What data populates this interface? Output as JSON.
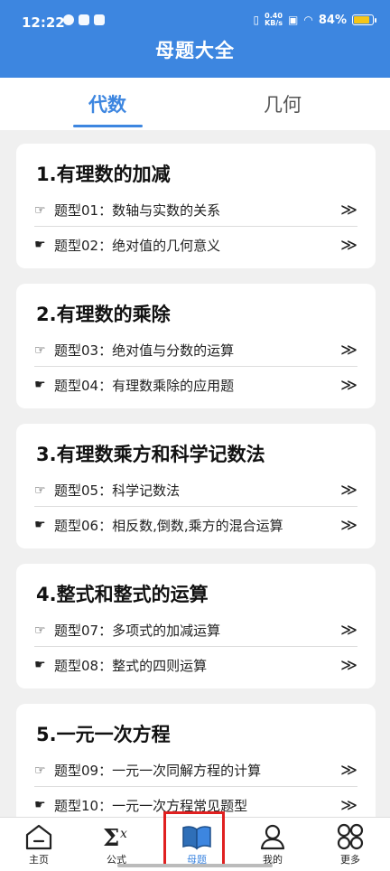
{
  "status_bar": {
    "time": "12:22",
    "net_speed_value": "0.40",
    "net_speed_unit": "KB/s",
    "battery": "84%",
    "battery_level": 0.84
  },
  "header": {
    "title": "母题大全"
  },
  "tabs": [
    {
      "label": "代数",
      "active": true
    },
    {
      "label": "几何",
      "active": false
    }
  ],
  "sections": [
    {
      "title": "1.有理数的加减",
      "items": [
        "题型01：数轴与实数的关系",
        "题型02：绝对值的几何意义"
      ]
    },
    {
      "title": "2.有理数的乘除",
      "items": [
        "题型03：绝对值与分数的运算",
        "题型04：有理数乘除的应用题"
      ]
    },
    {
      "title": "3.有理数乘方和科学记数法",
      "items": [
        "题型05：科学记数法",
        "题型06：相反数,倒数,乘方的混合运算"
      ]
    },
    {
      "title": "4.整式和整式的运算",
      "items": [
        "题型07：多项式的加减运算",
        "题型08：整式的四则运算"
      ]
    },
    {
      "title": "5.一元一次方程",
      "items": [
        "题型09：一元一次同解方程的计算",
        "题型10：一元一次方程常见题型"
      ]
    }
  ],
  "bottom_nav": [
    {
      "label": "主页",
      "icon": "home-icon"
    },
    {
      "label": "公式",
      "icon": "sigma-x-icon"
    },
    {
      "label": "母题",
      "icon": "open-book-icon",
      "active": true
    },
    {
      "label": "我的",
      "icon": "user-icon"
    },
    {
      "label": "更多",
      "icon": "grid-circles-icon"
    }
  ],
  "colors": {
    "brand": "#3d86e0",
    "highlight_box": "#e02020",
    "background": "#f0f0f0"
  }
}
